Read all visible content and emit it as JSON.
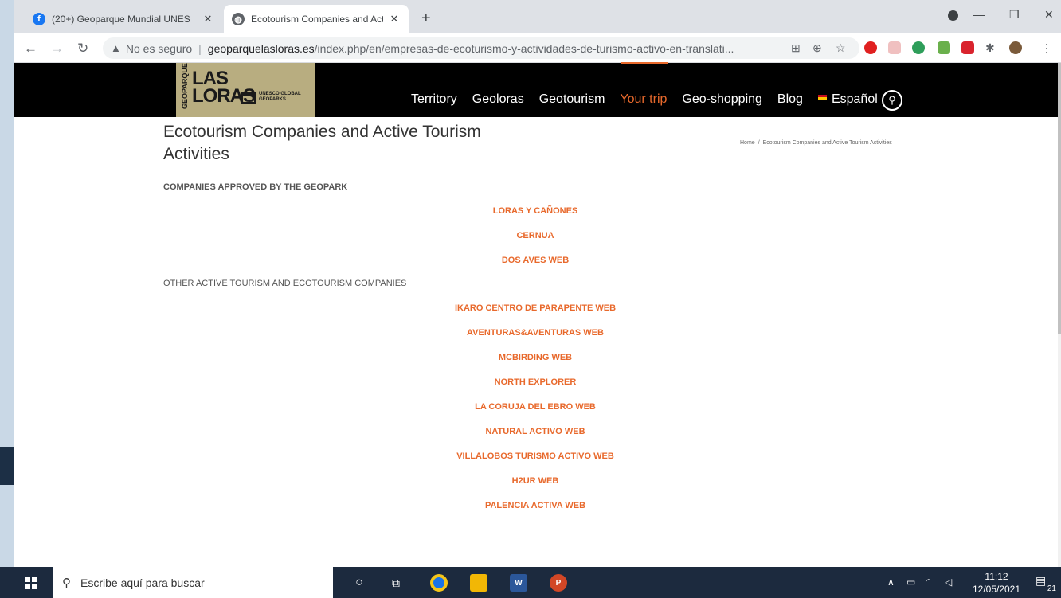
{
  "browser": {
    "tabs": [
      {
        "title": "(20+) Geoparque Mundial UNES",
        "icon": "facebook-icon",
        "active": false
      },
      {
        "title": "Ecotourism Companies and Activ",
        "icon": "globe-icon",
        "active": true
      }
    ],
    "new_tab": "+",
    "address": {
      "warning": "No es seguro",
      "domain": "geoparquelasloras.es",
      "path": "/index.php/en/empresas-de-ecoturismo-y-actividades-de-turismo-activo-en-translati..."
    }
  },
  "site": {
    "logo": {
      "side": "GEOPARQUE",
      "line1": "LAS",
      "line2": "LORAS",
      "unesco": "UNESCO GLOBAL GEOPARKS"
    },
    "nav": [
      {
        "label": "Territory"
      },
      {
        "label": "Geoloras"
      },
      {
        "label": "Geotourism"
      },
      {
        "label": "Your trip",
        "active": true
      },
      {
        "label": "Geo-shopping"
      },
      {
        "label": "Blog"
      }
    ],
    "language": "Español",
    "accent_color": "#e8692c"
  },
  "page": {
    "title": "Ecotourism Companies and Active Tourism Activities",
    "breadcrumb": {
      "home": "Home",
      "separator": "/",
      "current": "Ecotourism Companies and Active Tourism Activities"
    },
    "section_approved": "COMPANIES APPROVED BY THE GEOPARK",
    "approved": [
      "LORAS Y CAÑONES",
      "CERNUA",
      "DOS AVES WEB"
    ],
    "section_other": "OTHER ACTIVE TOURISM AND ECOTOURISM COMPANIES",
    "other": [
      "IKARO CENTRO DE PARAPENTE WEB",
      "AVENTURAS&AVENTURAS WEB",
      "MCBIRDING WEB",
      "NORTH EXPLORER",
      "LA CORUJA DEL EBRO WEB",
      "NATURAL ACTIVO WEB",
      "VILLALOBOS TURISMO ACTIVO WEB",
      "H2UR WEB",
      "PALENCIA ACTIVA WEB"
    ]
  },
  "taskbar": {
    "search_placeholder": "Escribe aquí para buscar",
    "time": "11:12",
    "date": "12/05/2021",
    "notifications": "21"
  }
}
